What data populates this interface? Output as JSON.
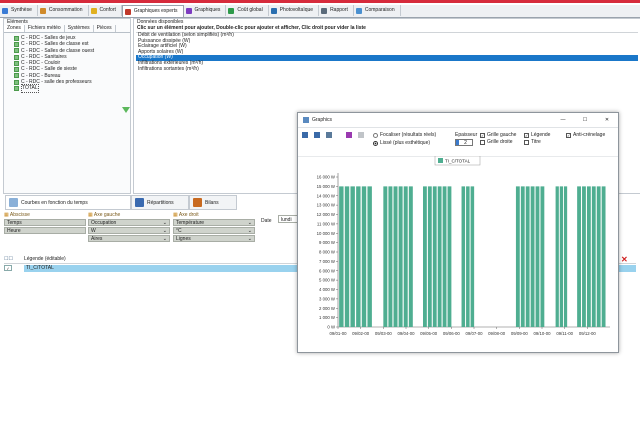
{
  "tabs": [
    {
      "label": "Synthèse",
      "icon": "synthesis-icon",
      "color": "#3a7bd5"
    },
    {
      "label": "Consommation",
      "icon": "consumption-icon",
      "color": "#d08a2a"
    },
    {
      "label": "Confort",
      "icon": "comfort-icon",
      "color": "#e0b020"
    },
    {
      "label": "Graphiques experts",
      "icon": "expert-charts-icon",
      "color": "#c0392b"
    },
    {
      "label": "Graphiques",
      "icon": "charts-icon",
      "color": "#7d3cc0"
    },
    {
      "label": "Coût global",
      "icon": "cost-icon",
      "color": "#2e9a4a"
    },
    {
      "label": "Photovoltaïque",
      "icon": "pv-icon",
      "color": "#2a6fb0"
    },
    {
      "label": "Rapport",
      "icon": "report-icon",
      "color": "#5a6a7a"
    },
    {
      "label": "Comparaison",
      "icon": "compare-icon",
      "color": "#4a90d0"
    }
  ],
  "elements": {
    "title": "Eléments",
    "subtabs": [
      "Zones",
      "Fichiers météo",
      "Systèmes",
      "Pièces"
    ],
    "items": [
      "C - RDC - Salles de jeux",
      "C - RDC - Salles de classe est",
      "C - RDC - Salles de classe ouest",
      "C - RDC - Sanitaires",
      "C - RDC - Couloir",
      "C - RDC - Salle de sieste",
      "C - RDC - Bureau",
      "C - RDC - salle des professeurs",
      "TOTAL"
    ]
  },
  "donnees": {
    "title": "Données disponibles",
    "hint": "Clic sur un élément pour ajouter, Double-clic pour ajouter et afficher, Clic droit pour vider la liste",
    "items": [
      "Débit de ventilation (selon simplifiés) (m³/h)",
      "Puissance dissipée (W)",
      "Eclairage artificiel (W)",
      "Apports solaires (W)",
      "Occupation (W)",
      "Infiltrations extérieures (m³/h)",
      "Infiltrations sortantes (m³/h)"
    ],
    "selected": 4
  },
  "bottom_tabs": [
    {
      "label": "Courbes en fonction du temps",
      "icon": "curves-icon"
    },
    {
      "label": "Répartitions",
      "icon": "distribution-icon"
    },
    {
      "label": "Bilans",
      "icon": "balance-icon"
    }
  ],
  "axes": {
    "abscisse": {
      "title": "Abscisse",
      "fields": [
        "Temps",
        "Heure"
      ]
    },
    "gauche": {
      "title": "Axe gauche",
      "fields": [
        "Occupation",
        "W",
        "Aires"
      ]
    },
    "droit": {
      "title": "Axe droit",
      "fields": [
        "Température",
        "°C",
        "Lignes"
      ]
    }
  },
  "date": {
    "label": "Date",
    "value": "lundi"
  },
  "legend": {
    "header": "Légende (éditable)",
    "row": "TI_C/TOTAL"
  },
  "graphics": {
    "title": "Graphics",
    "radio1": "Focaliser (résultats réels)",
    "radio2": "Lissé (plus esthétique)",
    "epaisseur_label": "Epaisseur",
    "epaisseur_value": "2",
    "cb_grille_gauche": "Grille gauche",
    "cb_grille_droite": "Grille droite",
    "cb_legende": "Légende",
    "cb_titre": "Titre",
    "cb_anticrenelage": "Anti-crénelage",
    "minimize": "—",
    "maximize": "☐",
    "close": "✕"
  },
  "chart_data": {
    "type": "bar",
    "legend": [
      "TI_C/TOTAL"
    ],
    "series_color": "#4fae91",
    "y_ticks": [
      "0 W",
      "1 000 W",
      "2 000 W",
      "3 000 W",
      "4 000 W",
      "5 000 W",
      "6 000 W",
      "7 000 W",
      "8 000 W",
      "9 000 W",
      "10 000 W",
      "11 000 W",
      "12 000 W",
      "13 000 W",
      "14 000 W",
      "15 000 W",
      "16 000 W"
    ],
    "ylim": [
      0,
      16000
    ],
    "x_ticks": [
      "09/01-00",
      "09/02-00",
      "09/03-00",
      "09/04-00",
      "09/05-00",
      "09/06-00",
      "09/07-00",
      "09/08-00",
      "09/09-00",
      "09/10-00",
      "09/11-00",
      "09/12-00"
    ],
    "x_range": [
      0,
      12
    ],
    "groups": [
      {
        "start": 0.05,
        "end": 1.55,
        "bars": 6
      },
      {
        "start": 2.0,
        "end": 3.35,
        "bars": 6
      },
      {
        "start": 3.75,
        "end": 5.05,
        "bars": 6
      },
      {
        "start": 5.45,
        "end": 6.05,
        "bars": 3
      },
      {
        "start": 7.85,
        "end": 9.15,
        "bars": 6
      },
      {
        "start": 9.6,
        "end": 10.15,
        "bars": 3
      },
      {
        "start": 10.55,
        "end": 11.85,
        "bars": 6
      }
    ],
    "value": 15000
  }
}
